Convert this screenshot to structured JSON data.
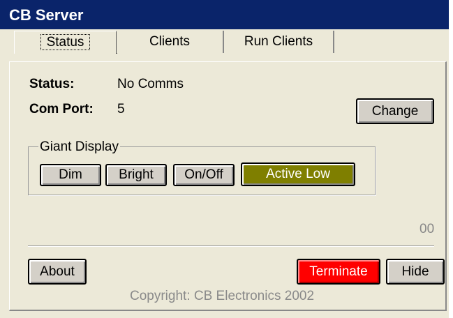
{
  "window": {
    "title": "CB Server"
  },
  "tabs": [
    {
      "label": "Status",
      "active": true
    },
    {
      "label": "Clients",
      "active": false
    },
    {
      "label": "Run Clients",
      "active": false
    }
  ],
  "status": {
    "status_label": "Status:",
    "status_value": "No Comms",
    "comport_label": "Com Port:",
    "comport_value": "5",
    "change_label": "Change"
  },
  "giant_display": {
    "group_label": "Giant Display",
    "dim_label": "Dim",
    "bright_label": "Bright",
    "onoff_label": "On/Off",
    "active_low_label": "Active Low",
    "active_low_color": "#7f7f00"
  },
  "counter": "00",
  "footer": {
    "about_label": "About",
    "terminate_label": "Terminate",
    "terminate_color": "#ff0000",
    "hide_label": "Hide",
    "copyright": "Copyright: CB Electronics 2002"
  }
}
